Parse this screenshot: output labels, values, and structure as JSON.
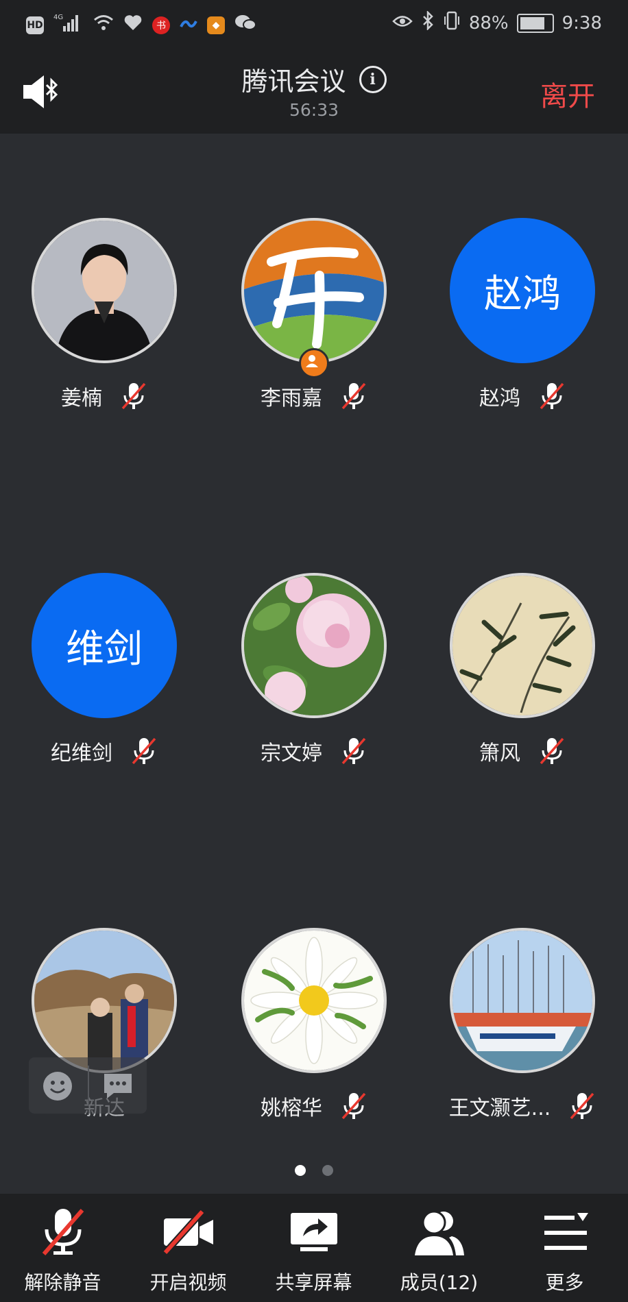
{
  "status_bar": {
    "left_icons": [
      "hd-icon",
      "signal-icon",
      "wifi-icon",
      "health-icon",
      "app-red-icon",
      "app-blue-icon",
      "app-orange-icon",
      "wechat-icon"
    ],
    "hd": "HD",
    "network": "4G",
    "battery": "88%",
    "battery_level": 0.88,
    "time": "9:38"
  },
  "header": {
    "title": "腾讯会议",
    "timer": "56:33",
    "leave_label": "离开"
  },
  "participants": [
    {
      "name": "姜楠",
      "avatar_type": "photo",
      "avatar_icon": "woman-portrait-icon",
      "mic": "muted"
    },
    {
      "name": "李雨嘉",
      "avatar_type": "photo",
      "avatar_icon": "calligraphy-logo-icon",
      "mic": "muted",
      "host": true
    },
    {
      "name": "赵鸿",
      "avatar_type": "text",
      "avatar_text": "赵鸿",
      "mic": "muted"
    },
    {
      "name": "纪维剑",
      "avatar_type": "text",
      "avatar_text": "维剑",
      "mic": "muted"
    },
    {
      "name": "宗文婷",
      "avatar_type": "photo",
      "avatar_icon": "peony-flower-icon",
      "mic": "muted"
    },
    {
      "name": "箫风",
      "avatar_type": "photo",
      "avatar_icon": "bamboo-painting-icon",
      "mic": "muted"
    },
    {
      "name": "新达",
      "avatar_type": "photo",
      "avatar_icon": "couple-landscape-icon",
      "mic": "none"
    },
    {
      "name": "姚榕华",
      "avatar_type": "photo",
      "avatar_icon": "white-flower-icon",
      "mic": "muted"
    },
    {
      "name": "王文灏艺...",
      "avatar_type": "photo",
      "avatar_icon": "harbor-boats-icon",
      "mic": "muted"
    }
  ],
  "pager": {
    "pages": 2,
    "current": 1
  },
  "bottom_bar": {
    "unmute_label": "解除静音",
    "video_label": "开启视频",
    "share_label": "共享屏幕",
    "members_label": "成员(12)",
    "more_label": "更多"
  },
  "colors": {
    "background": "#2b2d31",
    "bar": "#1f2022",
    "accent_blue": "#0a6bf2",
    "leave_red": "#f04a4a",
    "mute_slash": "#e8382f",
    "host_orange": "#f07c1b"
  }
}
